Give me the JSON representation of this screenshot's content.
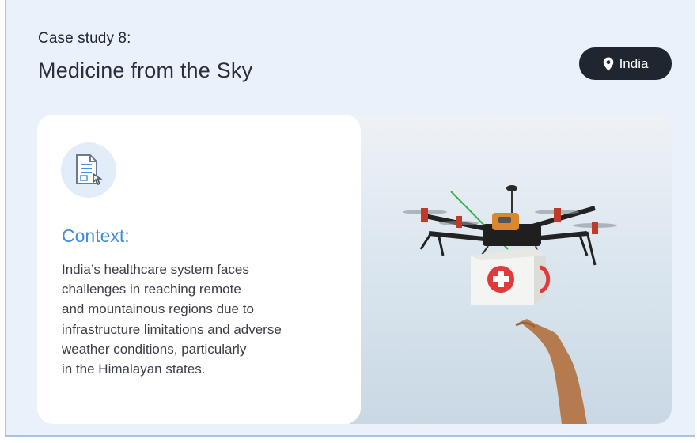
{
  "header": {
    "case_label": "Case study 8:",
    "case_title": "Medicine from the Sky",
    "location": "India"
  },
  "card": {
    "heading": "Context:",
    "body_lines": [
      "India’s healthcare system faces",
      "challenges in reaching remote",
      "and mountainous regions due to",
      "infrastructure limitations and adverse",
      "weather conditions, particularly",
      "in the Himalayan states."
    ]
  },
  "photo": {
    "subject": "drone-delivering-medical-box"
  },
  "colors": {
    "accent": "#3d8de4",
    "pill": "#20262f",
    "background": "#eaf1fb"
  },
  "icons": [
    "location-pin-icon",
    "document-pointer-icon"
  ]
}
